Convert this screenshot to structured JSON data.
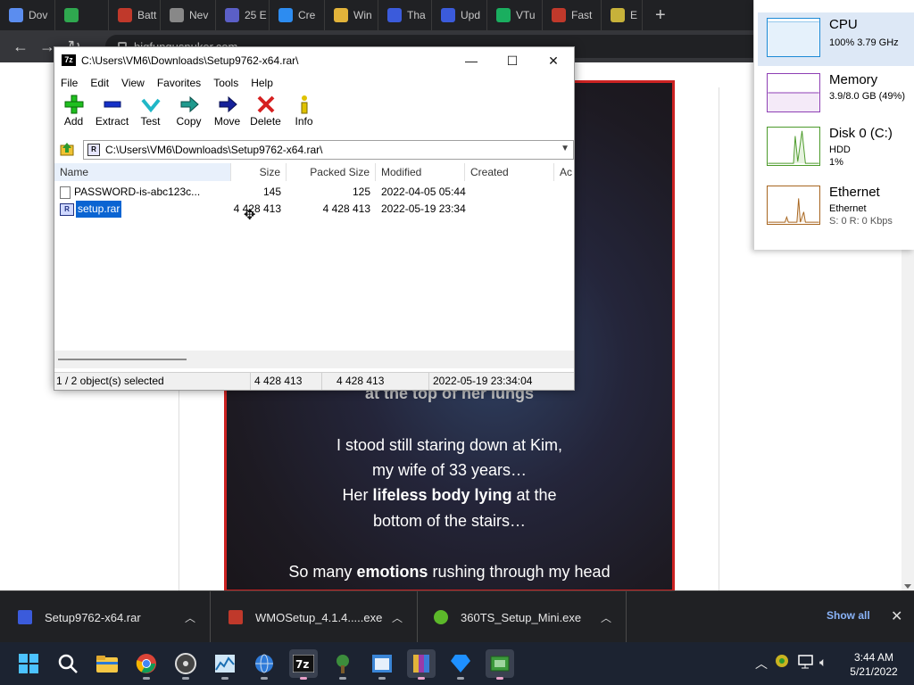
{
  "browser": {
    "tabs": [
      {
        "label": "Dov",
        "color": "#5b8def"
      },
      {
        "label": "",
        "color": "#2fa84f"
      },
      {
        "label": "Batt",
        "color": "#c0392b"
      },
      {
        "label": "Nev",
        "color": "#888888"
      },
      {
        "label": "25 E",
        "color": "#5b5fc7"
      },
      {
        "label": "Cre",
        "color": "#2d8cf0"
      },
      {
        "label": "Win",
        "color": "#e2b33a"
      },
      {
        "label": "Tha",
        "color": "#3b5bdb"
      },
      {
        "label": "Upd",
        "color": "#3b5bdb"
      },
      {
        "label": "VTu",
        "color": "#1aae5f"
      },
      {
        "label": "Fast",
        "color": "#c0392b"
      },
      {
        "label": "E",
        "color": "#c7b23a"
      }
    ],
    "new_tab": "+",
    "url": "bigfungusnuker.com"
  },
  "story": {
    "lines": [
      {
        "text": "at the top of her lungs",
        "style": "dim"
      },
      {
        "text": "I stood still staring down at Kim,"
      },
      {
        "text": "my wife of 33 years…"
      },
      {
        "pre": "Her ",
        "bold": "lifeless body lying",
        "post": " at the"
      },
      {
        "text": "bottom of the stairs…"
      },
      {
        "pre": "So many ",
        "bold": "emotions",
        "post": " rushing through my head"
      }
    ]
  },
  "task_manager": {
    "items": [
      {
        "title": "CPU",
        "sub1": "100% 3.79 GHz",
        "sub2": "",
        "color": "#1b8ad6"
      },
      {
        "title": "Memory",
        "sub1": "3.9/8.0 GB (49%)",
        "sub2": "",
        "color": "#8e3fb4"
      },
      {
        "title": "Disk 0 (C:)",
        "sub1": "HDD",
        "sub2": "1%",
        "color": "#4c9a2a"
      },
      {
        "title": "Ethernet",
        "sub1": "Ethernet",
        "sub2": "S: 0 R: 0 Kbps",
        "color": "#a7651f"
      }
    ]
  },
  "sevenzip": {
    "title": "C:\\Users\\VM6\\Downloads\\Setup9762-x64.rar\\",
    "menu": [
      "File",
      "Edit",
      "View",
      "Favorites",
      "Tools",
      "Help"
    ],
    "toolbar": [
      "Add",
      "Extract",
      "Test",
      "Copy",
      "Move",
      "Delete",
      "Info"
    ],
    "address": "C:\\Users\\VM6\\Downloads\\Setup9762-x64.rar\\",
    "columns": {
      "name": "Name",
      "size": "Size",
      "packed": "Packed Size",
      "modified": "Modified",
      "created": "Created",
      "accessed": "Ac"
    },
    "rows": [
      {
        "name": "PASSWORD-is-abc123c...",
        "size": "145",
        "packed": "125",
        "modified": "2022-04-05 05:44",
        "selected": false
      },
      {
        "name": "setup.rar",
        "size": "4 428 413",
        "packed": "4 428 413",
        "modified": "2022-05-19 23:34",
        "selected": true
      }
    ],
    "status": {
      "selection": "1 / 2 object(s) selected",
      "size": "4 428 413",
      "packed": "4 428 413",
      "date": "2022-05-19 23:34:04"
    }
  },
  "downloads": {
    "items": [
      {
        "name": "Setup9762-x64.rar",
        "color": "#3b5bdb"
      },
      {
        "name": "WMOSetup_4.1.4.....exe",
        "color": "#c0392b"
      },
      {
        "name": "360TS_Setup_Mini.exe",
        "color": "#5cb82a"
      }
    ],
    "show_all": "Show all",
    "close": "✕"
  },
  "taskbar": {
    "time": "3:44 AM",
    "date": "5/21/2022"
  }
}
